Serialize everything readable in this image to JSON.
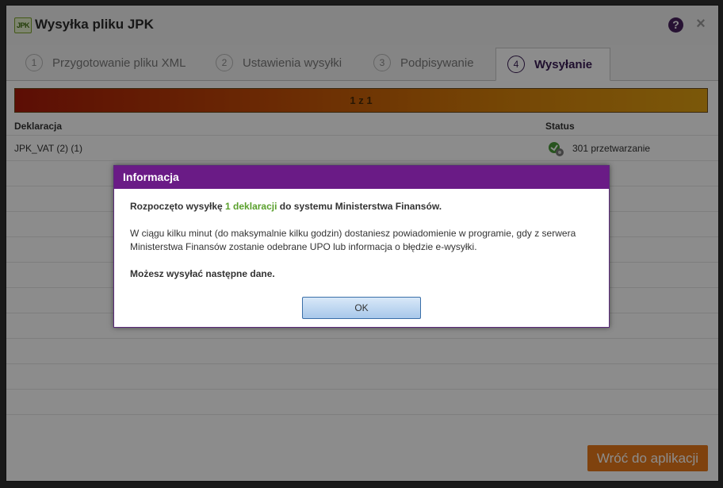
{
  "window": {
    "logo_text": "JPK",
    "title": "Wysyłka pliku JPK"
  },
  "tabs": [
    {
      "num": "1",
      "label": "Przygotowanie pliku XML"
    },
    {
      "num": "2",
      "label": "Ustawienia wysyłki"
    },
    {
      "num": "3",
      "label": "Podpisywanie"
    },
    {
      "num": "4",
      "label": "Wysyłanie"
    }
  ],
  "progress": {
    "label": "1 z 1",
    "fraction": 1.0
  },
  "table": {
    "headers": [
      "Deklaracja",
      "Status"
    ],
    "rows": [
      {
        "declaration": "JPK_VAT (2) (1)",
        "status": "301 przetwarzanie"
      }
    ]
  },
  "footer": {
    "back_label": "Wróć do aplikacji"
  },
  "dialog": {
    "title": "Informacja",
    "line1_prefix": "Rozpoczęto wysyłkę ",
    "line1_highlight": "1 deklaracji",
    "line1_suffix": " do systemu Ministerstwa Finansów.",
    "line2": "W ciągu kilku minut (do maksymalnie kilku godzin) dostaniesz powiadomienie w programie, gdy z serwera Ministerstwa Finansów zostanie odebrane UPO lub informacja o błędzie e-wysyłki.",
    "line3": "Możesz wysyłać następne dane.",
    "ok_label": "OK"
  },
  "colors": {
    "accent": "#6a1b86",
    "highlight": "#5aa02c",
    "action": "#e8791a"
  }
}
